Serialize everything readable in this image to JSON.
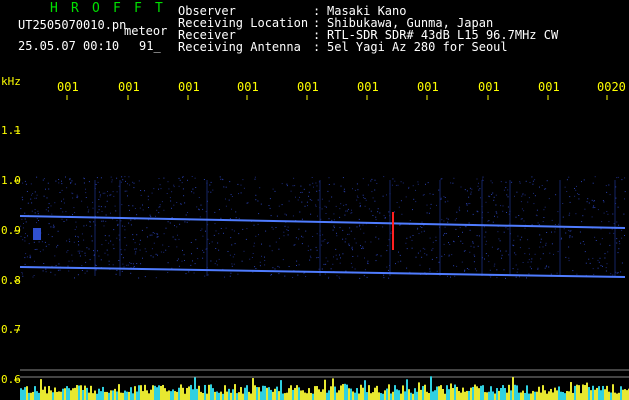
{
  "header": {
    "app_letters": [
      "H",
      "R",
      "O",
      "F",
      "F",
      "T"
    ],
    "filename": "UT2505070010.pn",
    "suffix": "meteor",
    "datetime": "25.05.07 00:10",
    "count": "91_"
  },
  "info": [
    {
      "label": "Observer",
      "value": "Masaki Kano"
    },
    {
      "label": "Receiving Location",
      "value": "Shibukawa, Gunma, Japan"
    },
    {
      "label": "Receiver",
      "value": "RTL-SDR SDR# 43dB L15 96.7MHz CW"
    },
    {
      "label": "Receiving Antenna",
      "value": "5el Yagi Az 280 for Seoul"
    }
  ],
  "separator": ":",
  "axis": {
    "unit": "kHz",
    "y_ticks": [
      "1.1",
      "1.0",
      "0.9",
      "0.8",
      "0.7",
      "0.6"
    ],
    "time_ticks": [
      "001",
      "001",
      "001",
      "001",
      "001",
      "001",
      "001",
      "001",
      "001",
      "0020"
    ]
  },
  "colors": {
    "header_green": "#00e000",
    "text_white": "#ffffff",
    "tick_yellow": "#ffff00",
    "trace_blue": "#4f7cff",
    "background": "#000000"
  }
}
